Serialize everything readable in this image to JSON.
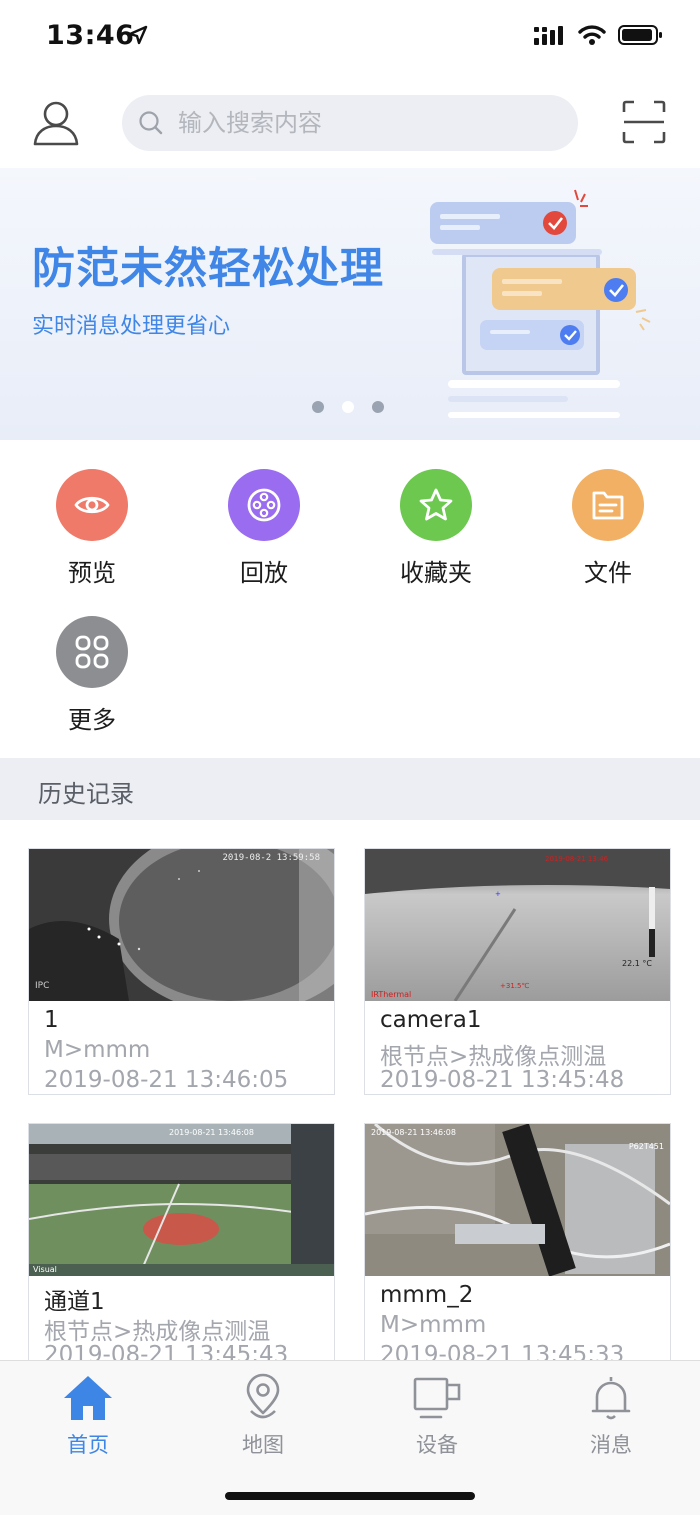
{
  "status_bar": {
    "time": "13:46"
  },
  "header": {
    "search_placeholder": "输入搜索内容"
  },
  "banner": {
    "title": "防范未然轻松处理",
    "subtitle": "实时消息处理更省心",
    "page_count": 3,
    "active_page": 1
  },
  "quick_actions": [
    {
      "label": "预览",
      "icon": "eye-icon",
      "color": "#ef7a6a"
    },
    {
      "label": "回放",
      "icon": "film-reel-icon",
      "color": "#9a6cf0"
    },
    {
      "label": "收藏夹",
      "icon": "star-icon",
      "color": "#6cc84e"
    },
    {
      "label": "文件",
      "icon": "folder-icon",
      "color": "#f2b064"
    },
    {
      "label": "更多",
      "icon": "grid-icon",
      "color": "#8d8e92"
    }
  ],
  "history": {
    "title": "历史记录",
    "cards": [
      {
        "name": "1",
        "path": "M>mmm",
        "time": "2019-08-21 13:46:05",
        "overlay": "2019-08-2  13:59:58",
        "corner": "IPC"
      },
      {
        "name": "camera1",
        "path": "根节点>热成像点测温",
        "time": "2019-08-21 13:45:48",
        "overlay": "22.1 °C",
        "corner": "IRThermal"
      },
      {
        "name": "通道1",
        "path": "根节点>热成像点测温",
        "time": "2019-08-21 13:45:43",
        "overlay": "2019-08-21 13:46:08",
        "corner": "Visual"
      },
      {
        "name": "mmm_2",
        "path": "M>mmm",
        "time": "2019-08-21 13:45:33",
        "overlay": "2019-08-21 13:46:08",
        "corner": "P62T451"
      }
    ]
  },
  "tabbar": {
    "tabs": [
      {
        "label": "首页",
        "icon": "home-icon",
        "active": true
      },
      {
        "label": "地图",
        "icon": "map-pin-icon",
        "active": false
      },
      {
        "label": "设备",
        "icon": "device-icon",
        "active": false
      },
      {
        "label": "消息",
        "icon": "bell-icon",
        "active": false
      }
    ]
  },
  "colors": {
    "accent": "#3f86e6",
    "inactive": "#8f9298",
    "section_bg": "#eceef3"
  }
}
